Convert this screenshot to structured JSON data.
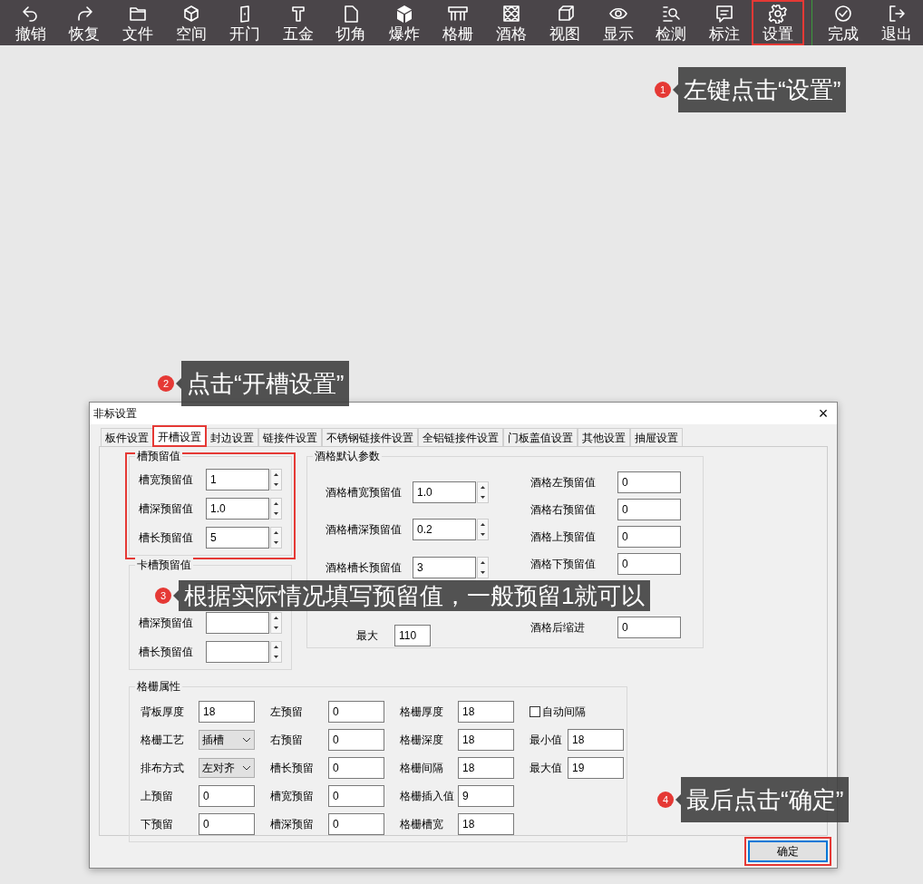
{
  "toolbar": {
    "items": [
      {
        "label": "撤销",
        "highlighted": false
      },
      {
        "label": "恢复",
        "highlighted": false
      },
      {
        "label": "文件",
        "highlighted": false
      },
      {
        "label": "空间",
        "highlighted": false
      },
      {
        "label": "开门",
        "highlighted": false
      },
      {
        "label": "五金",
        "highlighted": false
      },
      {
        "label": "切角",
        "highlighted": false
      },
      {
        "label": "爆炸",
        "highlighted": false
      },
      {
        "label": "格栅",
        "highlighted": false
      },
      {
        "label": "酒格",
        "highlighted": false
      },
      {
        "label": "视图",
        "highlighted": false
      },
      {
        "label": "显示",
        "highlighted": false
      },
      {
        "label": "检测",
        "highlighted": false
      },
      {
        "label": "标注",
        "highlighted": false
      },
      {
        "label": "设置",
        "highlighted": true
      },
      {
        "label": "完成",
        "highlighted": false
      },
      {
        "label": "退出",
        "highlighted": false
      }
    ]
  },
  "callouts": [
    {
      "number": "1",
      "text": "左键点击“设置”"
    },
    {
      "number": "2",
      "text": "点击“开槽设置”"
    },
    {
      "number": "3",
      "text": "根据实际情况填写预留值，一般预留1就可以"
    },
    {
      "number": "4",
      "text": "最后点击“确定”"
    }
  ],
  "dialog": {
    "title": "非标设置",
    "close": "×",
    "tabs": [
      {
        "label": "板件设置",
        "selected": false,
        "highlighted": false
      },
      {
        "label": "开槽设置",
        "selected": true,
        "highlighted": true
      },
      {
        "label": "封边设置",
        "selected": false,
        "highlighted": false
      },
      {
        "label": "链接件设置",
        "selected": false,
        "highlighted": false
      },
      {
        "label": "不锈钢链接件设置",
        "selected": false,
        "highlighted": false
      },
      {
        "label": "全铝链接件设置",
        "selected": false,
        "highlighted": false
      },
      {
        "label": "门板盖值设置",
        "selected": false,
        "highlighted": false
      },
      {
        "label": "其他设置",
        "selected": false,
        "highlighted": false
      },
      {
        "label": "抽屉设置",
        "selected": false,
        "highlighted": false
      }
    ],
    "slot_group": {
      "title": "槽预留值",
      "highlighted": true,
      "fields": [
        {
          "label": "槽宽预留值",
          "value": "1"
        },
        {
          "label": "槽深预留值",
          "value": "1.0"
        },
        {
          "label": "槽长预留值",
          "value": "5"
        }
      ]
    },
    "card_slot_group": {
      "title": "卡槽预留值",
      "fields": [
        {
          "label": "槽深预留值"
        },
        {
          "label": "槽长预留值"
        }
      ]
    },
    "wine_group": {
      "title": "酒格默认参数",
      "left": [
        {
          "label": "酒格槽宽预留值",
          "value": "1.0",
          "kind": "spin"
        },
        {
          "label": "酒格槽深预留值",
          "value": "0.2",
          "kind": "spin"
        },
        {
          "label": "酒格槽长预留值",
          "value": "3",
          "kind": "spin"
        },
        {
          "label": "最大",
          "value": "110",
          "kind": "short"
        }
      ],
      "right": [
        {
          "label": "酒格左预留值",
          "value": "0"
        },
        {
          "label": "酒格右预留值",
          "value": "0"
        },
        {
          "label": "酒格上预留值",
          "value": "0"
        },
        {
          "label": "酒格下预留值",
          "value": "0"
        },
        {
          "label": "酒格后缩进",
          "value": "0"
        }
      ]
    },
    "grille_group": {
      "title": "格栅属性",
      "rows": [
        [
          {
            "kind": "text",
            "label": "背板厚度",
            "value": "18"
          },
          {
            "kind": "text",
            "label": "左预留",
            "value": "0"
          },
          {
            "kind": "text",
            "label": "格栅厚度",
            "value": "18"
          },
          {
            "kind": "checkbox",
            "label": "自动间隔",
            "checked": false
          }
        ],
        [
          {
            "kind": "select",
            "label": "格栅工艺",
            "value": "插槽"
          },
          {
            "kind": "text",
            "label": "右预留",
            "value": "0"
          },
          {
            "kind": "text",
            "label": "格栅深度",
            "value": "18"
          },
          {
            "kind": "text",
            "label": "最小值",
            "value": "18"
          }
        ],
        [
          {
            "kind": "select",
            "label": "排布方式",
            "value": "左对齐"
          },
          {
            "kind": "text",
            "label": "槽长预留",
            "value": "0"
          },
          {
            "kind": "text",
            "label": "格栅间隔",
            "value": "18"
          },
          {
            "kind": "text",
            "label": "最大值",
            "value": "19"
          }
        ],
        [
          {
            "kind": "text",
            "label": "上预留",
            "value": "0"
          },
          {
            "kind": "text",
            "label": "槽宽预留",
            "value": "0"
          },
          {
            "kind": "text",
            "label": "格栅插入值",
            "value": "9"
          }
        ],
        [
          {
            "kind": "text",
            "label": "下预留",
            "value": "0"
          },
          {
            "kind": "text",
            "label": "槽深预留",
            "value": "0"
          },
          {
            "kind": "text",
            "label": "格栅槽宽",
            "value": "18"
          }
        ]
      ]
    },
    "ok_button": {
      "label": "确定",
      "highlighted": true
    }
  }
}
